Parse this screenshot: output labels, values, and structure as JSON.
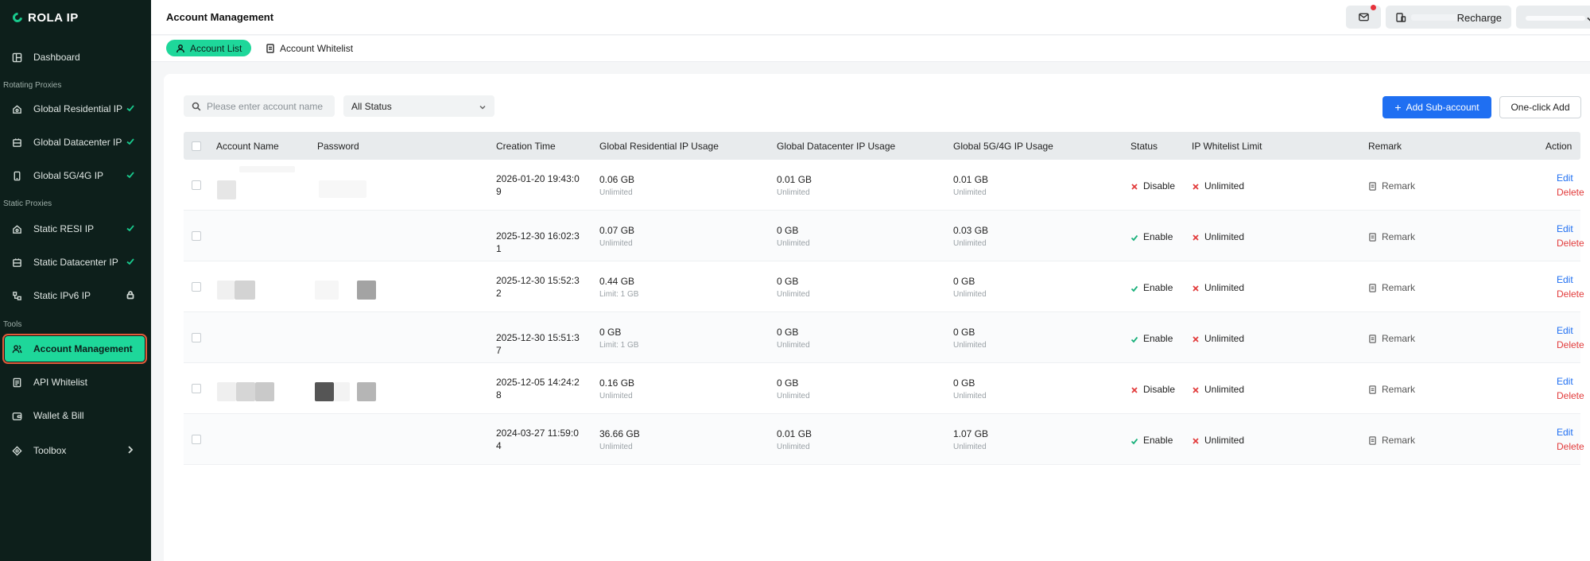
{
  "brand": {
    "name": "ROLA IP"
  },
  "sidebar": {
    "dashboard": "Dashboard",
    "section_rotating": "Rotating Proxies",
    "global_residential": "Global Residential IP",
    "global_datacenter": "Global Datacenter IP",
    "global_5g": "Global 5G/4G IP",
    "section_static": "Static Proxies",
    "static_resi": "Static RESI IP",
    "static_datacenter": "Static Datacenter IP",
    "static_ipv6": "Static IPv6 IP",
    "section_tools": "Tools",
    "account_management": "Account Management",
    "api_whitelist": "API Whitelist",
    "wallet_bill": "Wallet & Bill",
    "toolbox": "Toolbox"
  },
  "header": {
    "title": "Account Management",
    "recharge": "Recharge"
  },
  "tabs": {
    "account_list": "Account List",
    "account_whitelist": "Account Whitelist"
  },
  "filters": {
    "search_placeholder": "Please enter account name",
    "status": "All Status"
  },
  "buttons": {
    "add_sub_account": "Add Sub-account",
    "one_click_add": "One-click Add"
  },
  "table": {
    "columns": {
      "account_name": "Account Name",
      "password": "Password",
      "creation_time": "Creation Time",
      "global_residential": "Global Residential IP Usage",
      "global_datacenter": "Global Datacenter IP Usage",
      "global_5g": "Global 5G/4G IP Usage",
      "status": "Status",
      "whitelist_limit": "IP Whitelist Limit",
      "remark": "Remark",
      "action": "Action"
    },
    "rows": [
      {
        "time": "2026-01-20 19:43:09",
        "res": "0.06 GB",
        "res_sub": "Unlimited",
        "dc": "0.01 GB",
        "dc_sub": "Unlimited",
        "g5": "0.01 GB",
        "g5_sub": "Unlimited",
        "status": "Disable",
        "limit": "Unlimited",
        "remark": "Remark",
        "edit": "Edit",
        "delete": "Delete"
      },
      {
        "time": "2025-12-30 16:02:31",
        "res": "0.07 GB",
        "res_sub": "Unlimited",
        "dc": "0 GB",
        "dc_sub": "Unlimited",
        "g5": "0.03 GB",
        "g5_sub": "Unlimited",
        "status": "Enable",
        "limit": "Unlimited",
        "remark": "Remark",
        "edit": "Edit",
        "delete": "Delete"
      },
      {
        "time": "2025-12-30 15:52:32",
        "res": "0.44 GB",
        "res_sub": "Limit: 1 GB",
        "dc": "0 GB",
        "dc_sub": "Unlimited",
        "g5": "0 GB",
        "g5_sub": "Unlimited",
        "status": "Enable",
        "limit": "Unlimited",
        "remark": "Remark",
        "edit": "Edit",
        "delete": "Delete"
      },
      {
        "time": "2025-12-30 15:51:37",
        "res": "0 GB",
        "res_sub": "Limit: 1 GB",
        "dc": "0 GB",
        "dc_sub": "Unlimited",
        "g5": "0 GB",
        "g5_sub": "Unlimited",
        "status": "Enable",
        "limit": "Unlimited",
        "remark": "Remark",
        "edit": "Edit",
        "delete": "Delete"
      },
      {
        "time": "2025-12-05 14:24:28",
        "res": "0.16 GB",
        "res_sub": "Unlimited",
        "dc": "0 GB",
        "dc_sub": "Unlimited",
        "g5": "0 GB",
        "g5_sub": "Unlimited",
        "status": "Disable",
        "limit": "Unlimited",
        "remark": "Remark",
        "edit": "Edit",
        "delete": "Delete"
      },
      {
        "time": "2024-03-27 11:59:04",
        "res": "36.66 GB",
        "res_sub": "Unlimited",
        "dc": "0.01 GB",
        "dc_sub": "Unlimited",
        "g5": "1.07 GB",
        "g5_sub": "Unlimited",
        "status": "Enable",
        "limit": "Unlimited",
        "remark": "Remark",
        "edit": "Edit",
        "delete": "Delete"
      }
    ]
  },
  "colors": {
    "accent": "#1ed79a",
    "primary": "#1f6ff2",
    "danger": "#e23c3c",
    "success": "#18b07a",
    "sidebar_bg": "#0d1f1b"
  }
}
